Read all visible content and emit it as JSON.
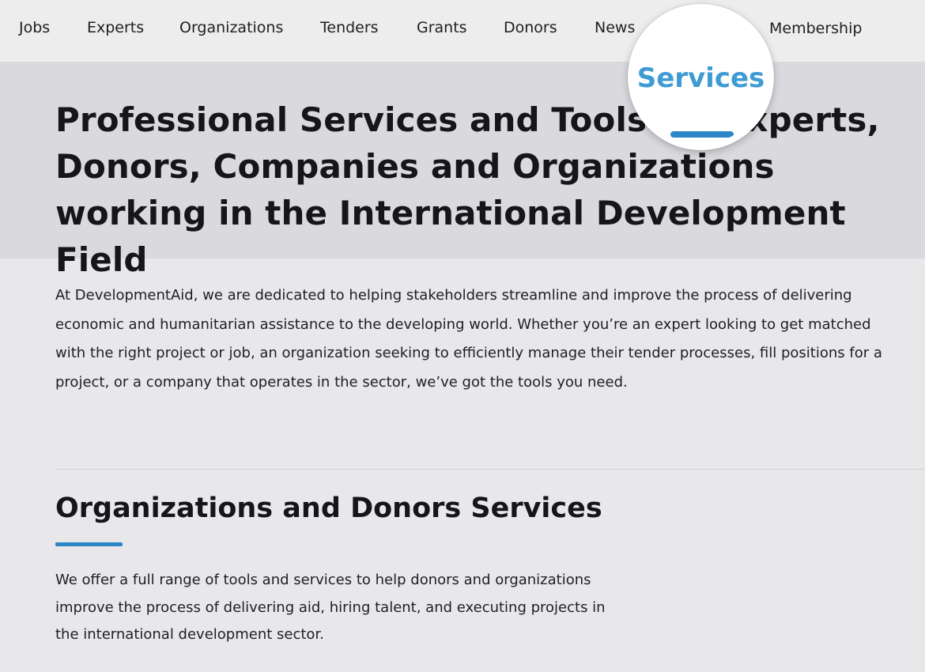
{
  "nav": {
    "items": [
      {
        "label": "Jobs"
      },
      {
        "label": "Experts"
      },
      {
        "label": "Organizations"
      },
      {
        "label": "Tenders"
      },
      {
        "label": "Grants"
      },
      {
        "label": "Donors"
      },
      {
        "label": "News"
      },
      {
        "label": "Services",
        "active": true
      },
      {
        "label": "Membership"
      }
    ],
    "accent_color": "#3f9bd3",
    "underline_color": "#2c87c9"
  },
  "hero": {
    "title": "Professional Services and Tools for Experts, Donors, Companies and Organizations working in the International Development Field"
  },
  "intro": {
    "text": "At DevelopmentAid, we are dedicated to helping stakeholders streamline and improve the process of delivering economic and humanitarian assistance to the developing world. Whether you’re an expert looking to get matched with the right project or job, an organization seeking to efficiently manage their tender processes, fill positions for a project, or a company that operates in the sector, we’ve got the tools you need."
  },
  "section": {
    "title": "Organizations and Donors Services",
    "text": "We offer a full range of tools and services to help donors and organizations improve the process of delivering aid, hiring talent, and executing projects in the international development sector."
  }
}
